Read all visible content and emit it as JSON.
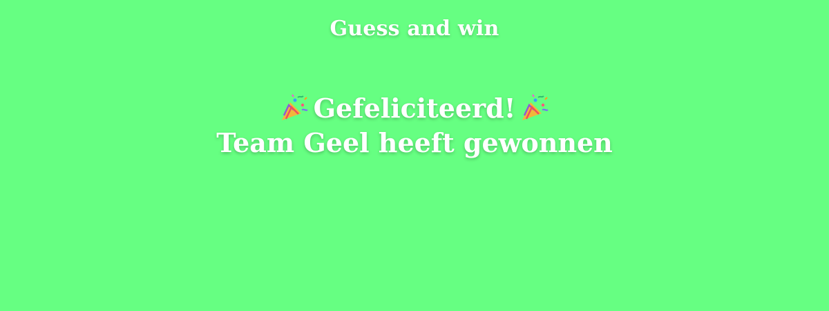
{
  "app": {
    "title": "Guess and win"
  },
  "result": {
    "congrats": "Gefeliciteerd!",
    "winner_message": "Team Geel heeft gewonnen",
    "icon_left": "party-popper-icon",
    "icon_right": "party-popper-icon"
  },
  "colors": {
    "background": "#66ff82",
    "text": "#ffffff"
  }
}
